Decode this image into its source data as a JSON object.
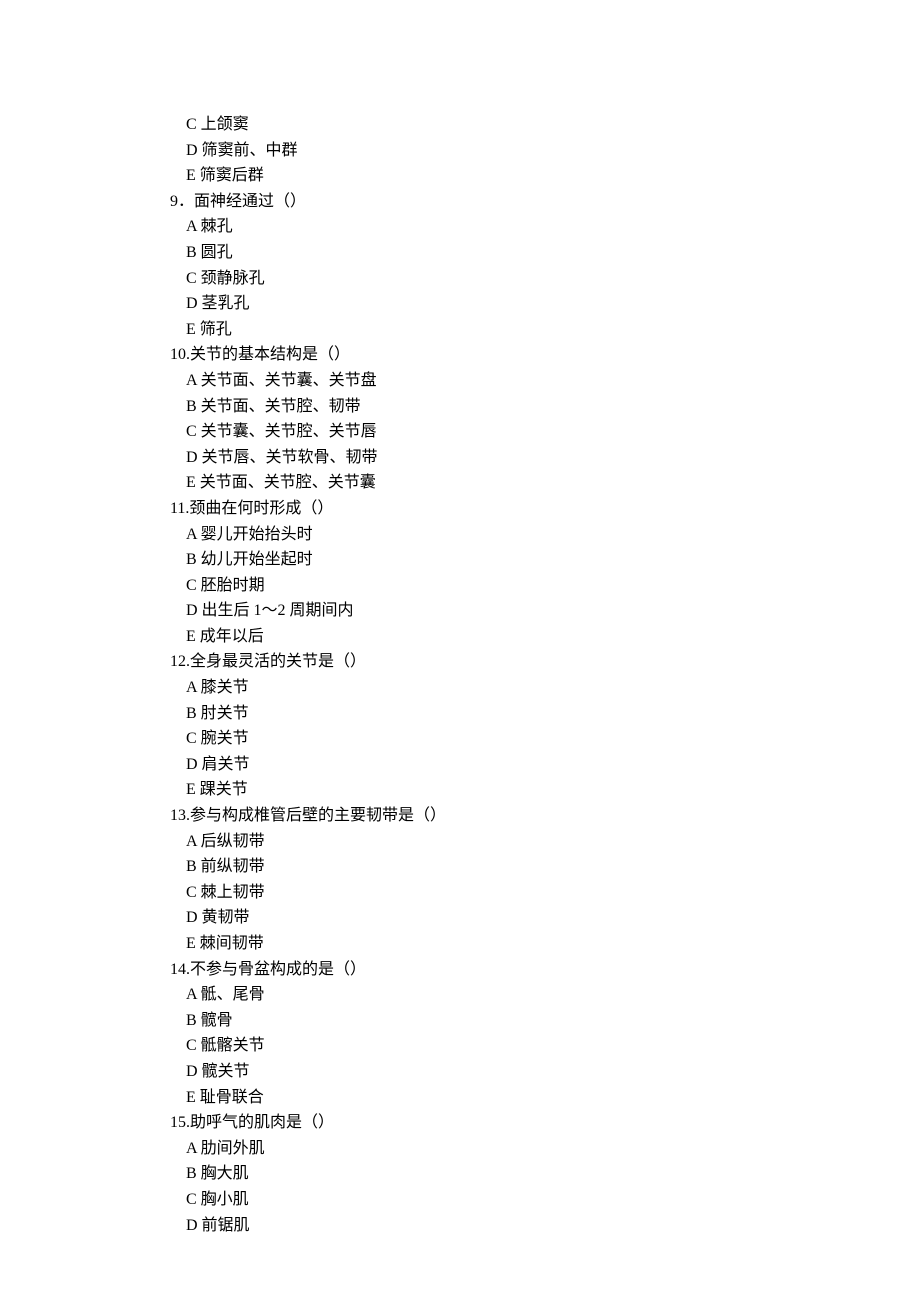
{
  "lines": [
    {
      "class": "option-line",
      "text": "C 上颌窦"
    },
    {
      "class": "option-line",
      "text": "D 筛窦前、中群"
    },
    {
      "class": "option-line",
      "text": "E 筛窦后群"
    },
    {
      "class": "question-line",
      "text": "9．面神经通过（）"
    },
    {
      "class": "option-line",
      "text": "A 棘孔"
    },
    {
      "class": "option-line",
      "text": "B 圆孔"
    },
    {
      "class": "option-line",
      "text": "C 颈静脉孔"
    },
    {
      "class": "option-line",
      "text": "D 茎乳孔"
    },
    {
      "class": "option-line",
      "text": "E 筛孔"
    },
    {
      "class": "question-line",
      "text": "10.关节的基本结构是（）"
    },
    {
      "class": "option-line",
      "text": "A 关节面、关节囊、关节盘"
    },
    {
      "class": "option-line",
      "text": "B 关节面、关节腔、韧带"
    },
    {
      "class": "option-line",
      "text": "C 关节囊、关节腔、关节唇"
    },
    {
      "class": "option-line",
      "text": "D 关节唇、关节软骨、韧带"
    },
    {
      "class": "option-line",
      "text": "E 关节面、关节腔、关节囊"
    },
    {
      "class": "question-line",
      "text": "11.颈曲在何时形成（）"
    },
    {
      "class": "option-line",
      "text": "A 婴儿开始抬头时"
    },
    {
      "class": "option-line",
      "text": "B 幼儿开始坐起时"
    },
    {
      "class": "option-line",
      "text": "C 胚胎时期"
    },
    {
      "class": "option-line",
      "text": "D 出生后 1～2 周期间内"
    },
    {
      "class": "option-line",
      "text": "E 成年以后"
    },
    {
      "class": "question-line",
      "text": "12.全身最灵活的关节是（）"
    },
    {
      "class": "option-line",
      "text": "A 膝关节"
    },
    {
      "class": "option-line",
      "text": "B 肘关节"
    },
    {
      "class": "option-line",
      "text": "C 腕关节"
    },
    {
      "class": "option-line",
      "text": "D 肩关节"
    },
    {
      "class": "option-line",
      "text": "E 踝关节"
    },
    {
      "class": "question-line",
      "text": "13.参与构成椎管后壁的主要韧带是（）"
    },
    {
      "class": "option-line",
      "text": "A 后纵韧带"
    },
    {
      "class": "option-line",
      "text": "B 前纵韧带"
    },
    {
      "class": "option-line",
      "text": "C 棘上韧带"
    },
    {
      "class": "option-line",
      "text": "D 黄韧带"
    },
    {
      "class": "option-line",
      "text": "E 棘间韧带"
    },
    {
      "class": "question-line",
      "text": "14.不参与骨盆构成的是（）"
    },
    {
      "class": "option-line",
      "text": "A 骶、尾骨"
    },
    {
      "class": "option-line",
      "text": "B 髋骨"
    },
    {
      "class": "option-line",
      "text": "C 骶髂关节"
    },
    {
      "class": "option-line",
      "text": "D 髋关节"
    },
    {
      "class": "option-line",
      "text": "E 耻骨联合"
    },
    {
      "class": "question-line",
      "text": "15.助呼气的肌肉是（）"
    },
    {
      "class": "option-line",
      "text": "A 肋间外肌"
    },
    {
      "class": "option-line",
      "text": "B 胸大肌"
    },
    {
      "class": "option-line",
      "text": "C 胸小肌"
    },
    {
      "class": "option-line",
      "text": "D 前锯肌"
    }
  ]
}
